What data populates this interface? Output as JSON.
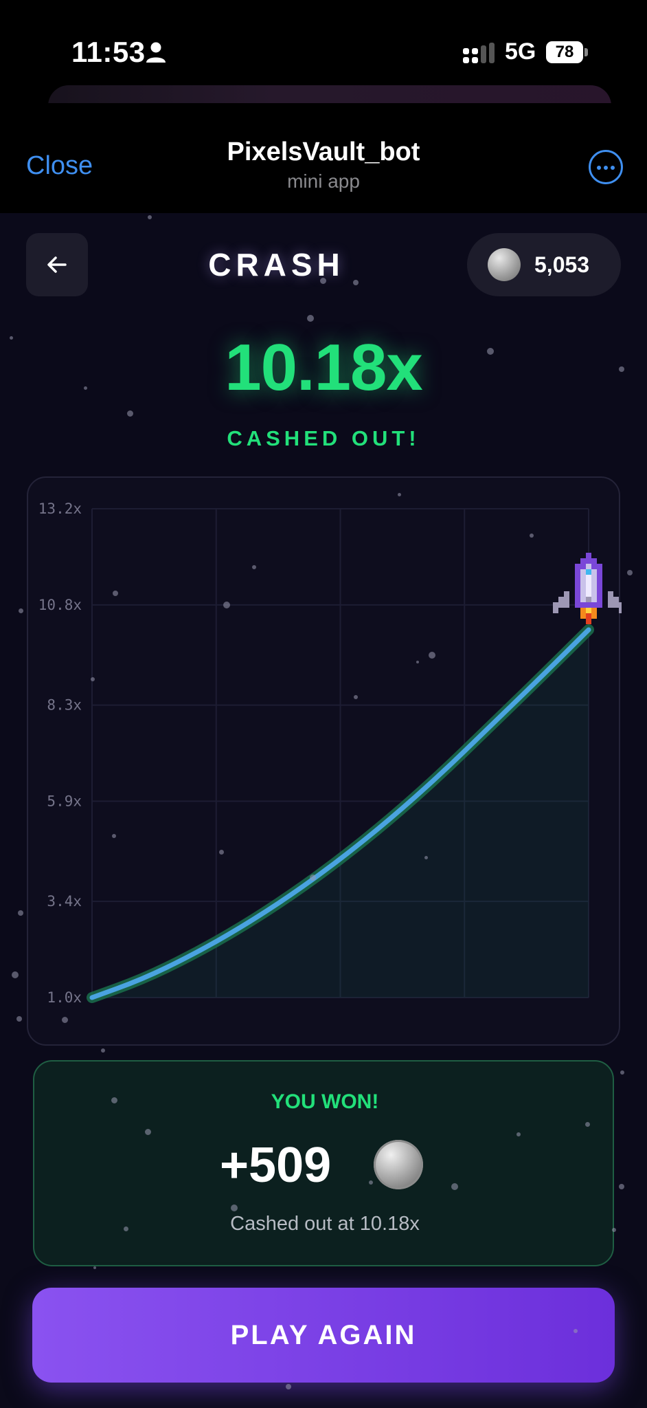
{
  "status_bar": {
    "time": "11:53",
    "network": "5G",
    "battery": "78"
  },
  "telegram": {
    "close_label": "Close",
    "bot_name": "PixelsVault_bot",
    "bot_subtitle": "mini app"
  },
  "app": {
    "title": "CRASH",
    "balance": "5,053",
    "multiplier": "10.18x",
    "status": "CASHED OUT!",
    "result": {
      "title": "YOU WON!",
      "amount": "+509",
      "subtitle": "Cashed out at 10.18x"
    },
    "play_again_label": "PLAY AGAIN"
  },
  "colors": {
    "accent_green": "#22e07a",
    "accent_purple": "#7b3fe8",
    "curve": "#4aa3e0",
    "link_blue": "#3f8ff0"
  },
  "chart_data": {
    "type": "line",
    "y_tick_labels": [
      "13.2x",
      "10.8x",
      "8.3x",
      "5.9x",
      "3.4x",
      "1.0x"
    ],
    "y_ticks": [
      13.2,
      10.8,
      8.3,
      5.9,
      3.4,
      1.0
    ],
    "ylim": [
      1.0,
      13.2
    ],
    "x": [
      0,
      0.1,
      0.2,
      0.3,
      0.4,
      0.5,
      0.6,
      0.7,
      0.8,
      0.9,
      1.0
    ],
    "values": [
      1.0,
      1.45,
      2.05,
      2.75,
      3.55,
      4.45,
      5.45,
      6.55,
      7.75,
      8.95,
      10.18
    ],
    "grid": true,
    "final_multiplier": 10.18,
    "marker": "rocket-icon"
  }
}
